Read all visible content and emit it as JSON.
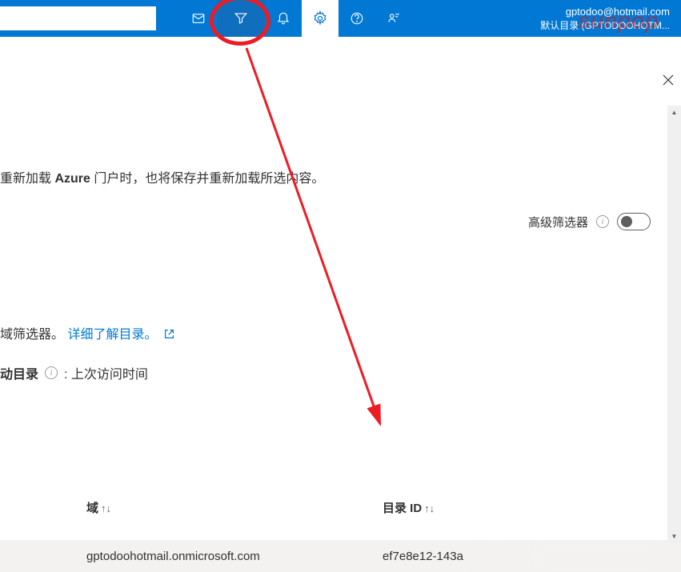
{
  "header": {
    "search_placeholder": "",
    "user_email": "gptodoo@hotmail.com",
    "user_directory": "默认目录 (GPTODOOHOTM..."
  },
  "watermark": "sunpop",
  "main": {
    "reload_text_prefix": "重新加载 ",
    "reload_text_bold": "Azure",
    "reload_text_suffix": " 门户时，也将保存并重新加载所选内容。",
    "advanced_filter_label": "高级筛选器",
    "directory_filter_text": "域筛选器。",
    "directory_link_text": "详细了解目录。",
    "startup_prefix": "动目录",
    "startup_suffix": ": 上次访问时间"
  },
  "table": {
    "headers": {
      "domain": "域",
      "directory_id": "目录 ID"
    },
    "rows": [
      {
        "domain": "gptodoohotmail.onmicrosoft.com",
        "directory_id": "ef7e8e12-143a"
      }
    ]
  }
}
